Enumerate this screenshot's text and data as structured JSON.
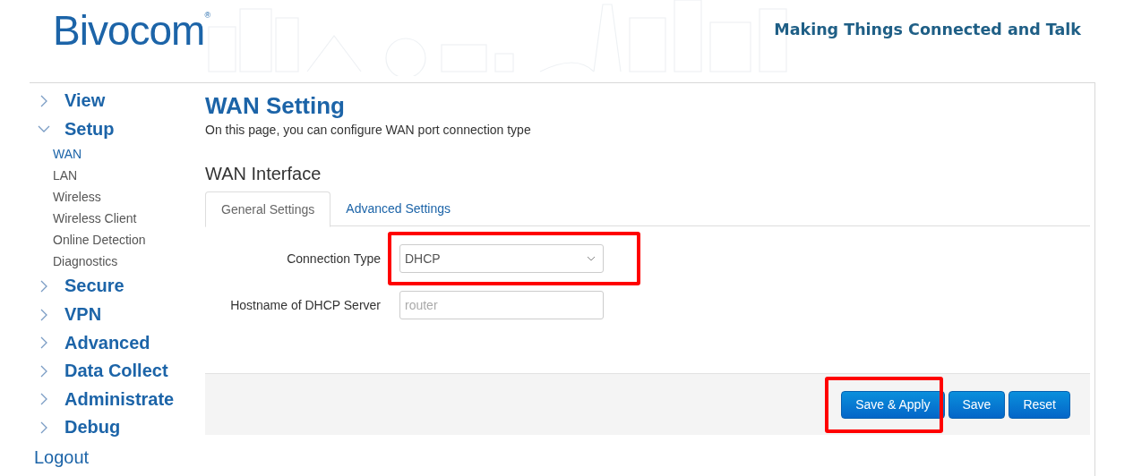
{
  "header": {
    "logo": "Bivocom",
    "logo_mark": "®",
    "tagline": "Making Things Connected and Talk"
  },
  "sidebar": {
    "items": [
      {
        "label": "View",
        "expanded": false
      },
      {
        "label": "Setup",
        "expanded": true,
        "children": [
          {
            "label": "WAN",
            "selected": true
          },
          {
            "label": "LAN",
            "selected": false
          },
          {
            "label": "Wireless",
            "selected": false
          },
          {
            "label": "Wireless Client",
            "selected": false
          },
          {
            "label": "Online Detection",
            "selected": false
          },
          {
            "label": "Diagnostics",
            "selected": false
          }
        ]
      },
      {
        "label": "Secure",
        "expanded": false
      },
      {
        "label": "VPN",
        "expanded": false
      },
      {
        "label": "Advanced",
        "expanded": false
      },
      {
        "label": "Data Collect",
        "expanded": false
      },
      {
        "label": "Administrate",
        "expanded": false
      },
      {
        "label": "Debug",
        "expanded": false
      }
    ],
    "logout": "Logout"
  },
  "page": {
    "title": "WAN Setting",
    "description": "On this page, you can configure WAN port connection type",
    "section": "WAN Interface"
  },
  "tabs": [
    {
      "label": "General Settings",
      "selected": true
    },
    {
      "label": "Advanced Settings",
      "selected": false
    }
  ],
  "fields": [
    {
      "kind": "select",
      "label": "Connection Type",
      "value": "DHCP",
      "highlighted": true
    },
    {
      "kind": "text",
      "label": "Hostname of DHCP Server",
      "placeholder": "router",
      "highlighted": false
    }
  ],
  "buttons": [
    {
      "label": "Save & Apply",
      "highlighted": true
    },
    {
      "label": "Save",
      "highlighted": false
    },
    {
      "label": "Reset",
      "highlighted": false
    }
  ]
}
